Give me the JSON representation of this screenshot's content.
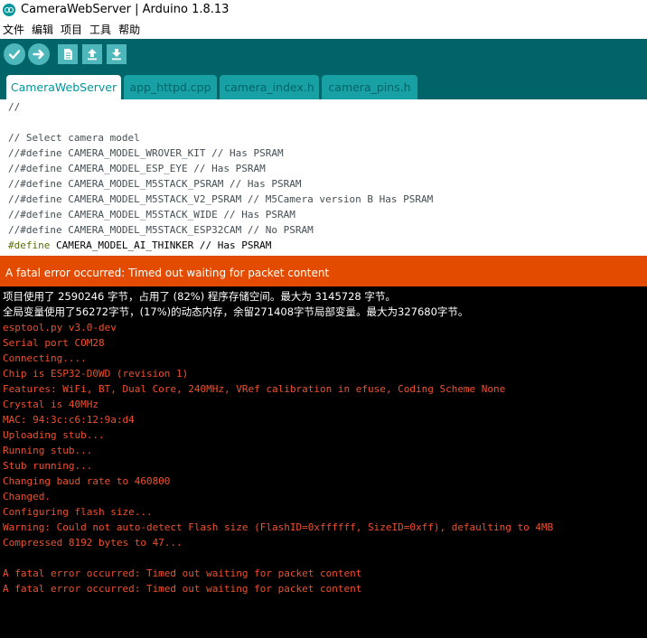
{
  "window": {
    "title": "CameraWebServer | Arduino 1.8.13"
  },
  "menu": [
    "文件",
    "编辑",
    "项目",
    "工具",
    "帮助"
  ],
  "toolbar": {
    "buttons": [
      "verify-icon",
      "upload-icon",
      "new-icon",
      "open-icon",
      "save-icon"
    ]
  },
  "tabs": [
    {
      "label": "CameraWebServer",
      "active": true
    },
    {
      "label": "app_httpd.cpp",
      "active": false
    },
    {
      "label": "camera_index.h",
      "active": false
    },
    {
      "label": "camera_pins.h",
      "active": false
    }
  ],
  "editor": {
    "lines": [
      "//",
      "",
      "// Select camera model",
      "//#define CAMERA_MODEL_WROVER_KIT // Has PSRAM",
      "//#define CAMERA_MODEL_ESP_EYE // Has PSRAM",
      "//#define CAMERA_MODEL_M5STACK_PSRAM // Has PSRAM",
      "//#define CAMERA_MODEL_M5STACK_V2_PSRAM // M5Camera version B Has PSRAM",
      "//#define CAMERA_MODEL_M5STACK_WIDE // Has PSRAM",
      "//#define CAMERA_MODEL_M5STACK_ESP32CAM // No PSRAM"
    ],
    "active_line": {
      "keyword": "#define",
      "rest": " CAMERA_MODEL_AI_THINKER // Has PSRAM"
    }
  },
  "status": {
    "error": "A fatal error occurred: Timed out waiting for packet content"
  },
  "console": {
    "info_lines": [
      "项目使用了 2590246 字节，占用了 (82%) 程序存储空间。最大为 3145728 字节。",
      "全局变量使用了56272字节，(17%)的动态内存，余留271408字节局部变量。最大为327680字节。"
    ],
    "lines": [
      "esptool.py v3.0-dev",
      "Serial port COM28",
      "Connecting....",
      "Chip is ESP32-D0WD (revision 1)",
      "Features: WiFi, BT, Dual Core, 240MHz, VRef calibration in efuse, Coding Scheme None",
      "Crystal is 40MHz",
      "MAC: 94:3c:c6:12:9a:d4",
      "Uploading stub...",
      "Running stub...",
      "Stub running...",
      "Changing baud rate to 460800",
      "Changed.",
      "Configuring flash size...",
      "Warning: Could not auto-detect Flash size (FlashID=0xffffff, SizeID=0xff), defaulting to 4MB",
      "Compressed 8192 bytes to 47...",
      "",
      "A fatal error occurred: Timed out waiting for packet content",
      "A fatal error occurred: Timed out waiting for packet content"
    ]
  },
  "colors": {
    "toolbar": "#006468",
    "tab": "#17a1a5",
    "accent": "#00979c",
    "error": "#e34c00",
    "console_text": "#f0502e"
  }
}
